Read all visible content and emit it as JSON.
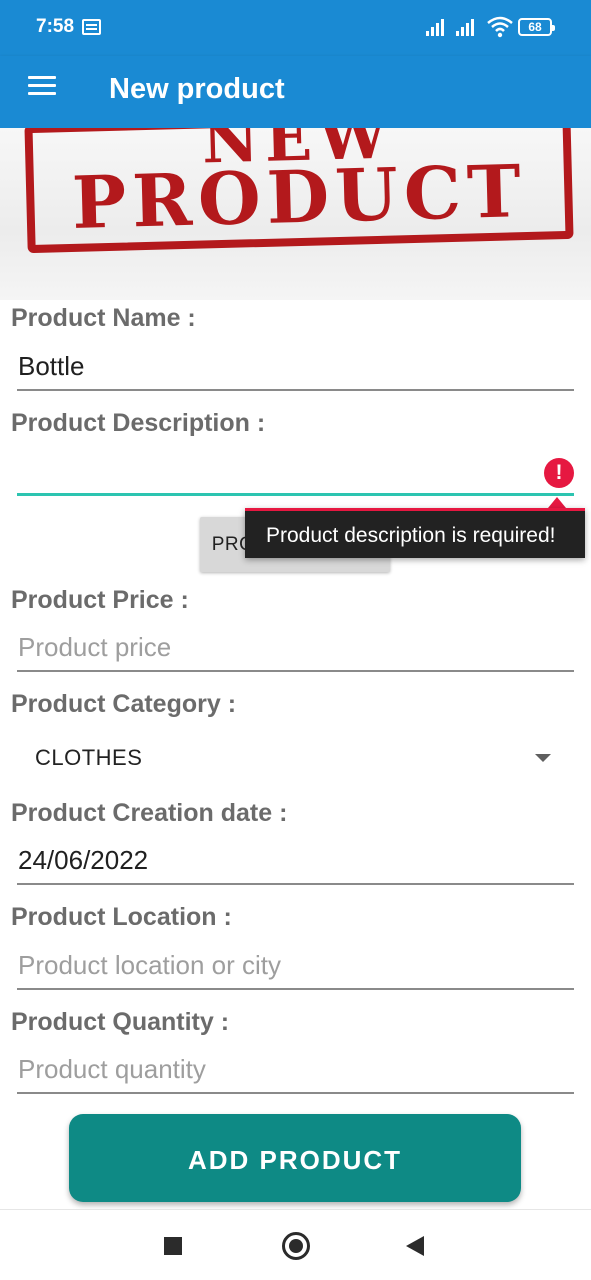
{
  "status_bar": {
    "time": "7:58",
    "battery": "68",
    "icons": [
      "sim-card-icon",
      "signal-icon",
      "signal-icon",
      "wifi-icon",
      "battery-icon"
    ]
  },
  "app_bar": {
    "title": "New product",
    "menu_icon": "hamburger-menu-icon"
  },
  "banner": {
    "line1": "NEW",
    "line2": "PRODUCT"
  },
  "form": {
    "name": {
      "label": "Product Name :",
      "value": "Bottle"
    },
    "description": {
      "label": "Product Description :",
      "value": "",
      "error": "Product description is required!",
      "error_icon": "exclamation-icon"
    },
    "image_button": "PRODUCT IMAGE",
    "price": {
      "label": "Product Price :",
      "placeholder": "Product price"
    },
    "category": {
      "label": "Product Category :",
      "selected": "CLOTHES"
    },
    "date": {
      "label": "Product Creation date :",
      "value": "24/06/2022"
    },
    "location": {
      "label": "Product Location :",
      "placeholder": "Product location or city"
    },
    "quantity": {
      "label": "Product Quantity :",
      "placeholder": "Product quantity"
    },
    "submit": "ADD PRODUCT"
  },
  "nav_bar": {
    "icons": [
      "recents-square-icon",
      "home-circle-icon",
      "back-triangle-icon"
    ]
  },
  "colors": {
    "primary": "#1a8ad3",
    "accent": "#0e8a85",
    "error": "#e61841",
    "focused_underline": "#2cc4b0",
    "label": "#6b6b6b"
  }
}
